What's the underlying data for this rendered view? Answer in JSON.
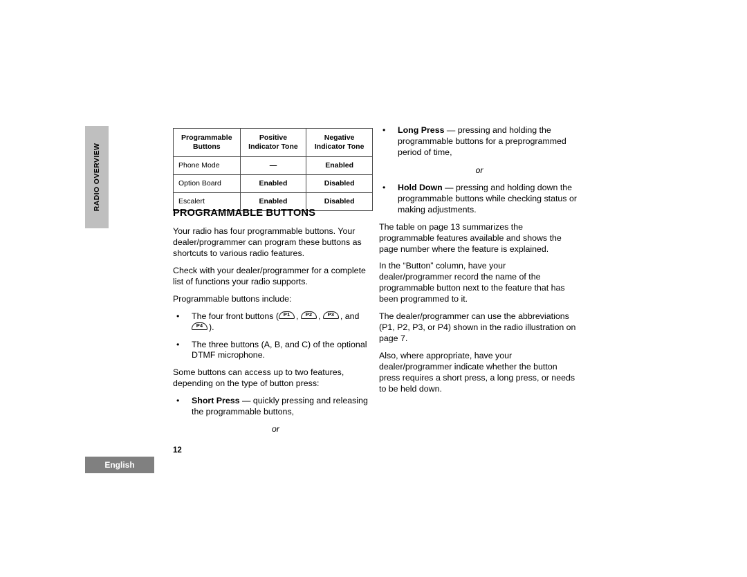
{
  "side_tab": {
    "label": "RADIO OVERVIEW"
  },
  "table": {
    "headers": [
      "Programmable Buttons",
      "Positive Indicator Tone",
      "Negative Indicator Tone"
    ],
    "header_lines": [
      [
        "Programmable",
        "Buttons"
      ],
      [
        "Positive",
        "Indicator Tone"
      ],
      [
        "Negative",
        "Indicator Tone"
      ]
    ],
    "rows": [
      [
        "Phone Mode",
        "—",
        "Enabled"
      ],
      [
        "Option Board",
        "Enabled",
        "Disabled"
      ],
      [
        "Escalert",
        "Enabled",
        "Disabled"
      ]
    ]
  },
  "heading": "PROGRAMMABLE BUTTONS",
  "left_column": {
    "para_1": "Your radio has four programmable buttons. Your dealer/programmer can program these buttons as shortcuts to various radio features.",
    "para_2": "Check with your dealer/programmer for a complete list of functions your radio supports.",
    "para_3": "Programmable buttons include:",
    "bullet_1": {
      "prefix": "The four front buttons (",
      "btn_1": "P1",
      "sep_1": ", ",
      "btn_2": "P2",
      "sep_2": ", ",
      "btn_3": "P3",
      "sep_3": ", and ",
      "btn_4": "P4",
      "suffix": ")."
    },
    "bullet_2": "The three buttons (A, B, and C) of the optional DTMF microphone.",
    "para_4": "Some buttons can access up to two features, depending on the type of button press:",
    "bullet_3_bold": "Short Press",
    "bullet_3_rest": " — quickly pressing and releasing the programmable buttons,",
    "or_label": "or"
  },
  "right_column": {
    "bullet_1_bold": "Long Press",
    "bullet_1_rest": " — pressing and holding the programmable buttons for a preprogrammed period of time,",
    "or_label": "or",
    "bullet_2_bold": "Hold Down",
    "bullet_2_rest": " — pressing and holding down the programmable buttons while checking status or making adjustments.",
    "para_1": "The table on page 13 summarizes the programmable features available and shows the page number where the feature is explained.",
    "para_2": "In the “Button” column, have your dealer/programmer record the name of the programmable button next to the feature that has been programmed to it.",
    "para_3": "The dealer/programmer can use the abbreviations (P1, P2, P3, or P4) shown in the radio illustration on page 7.",
    "para_4": "Also, where appropriate, have your dealer/programmer indicate whether the button press requires a short press, a long press, or needs to be held down."
  },
  "footer": {
    "page_number": "12",
    "language": "English"
  },
  "colors": {
    "side_tab_gray": "#bfbfbf",
    "language_box_gray": "#808080",
    "text": "#000000",
    "page_background": "#ffffff"
  },
  "bullet_glyph": "•"
}
